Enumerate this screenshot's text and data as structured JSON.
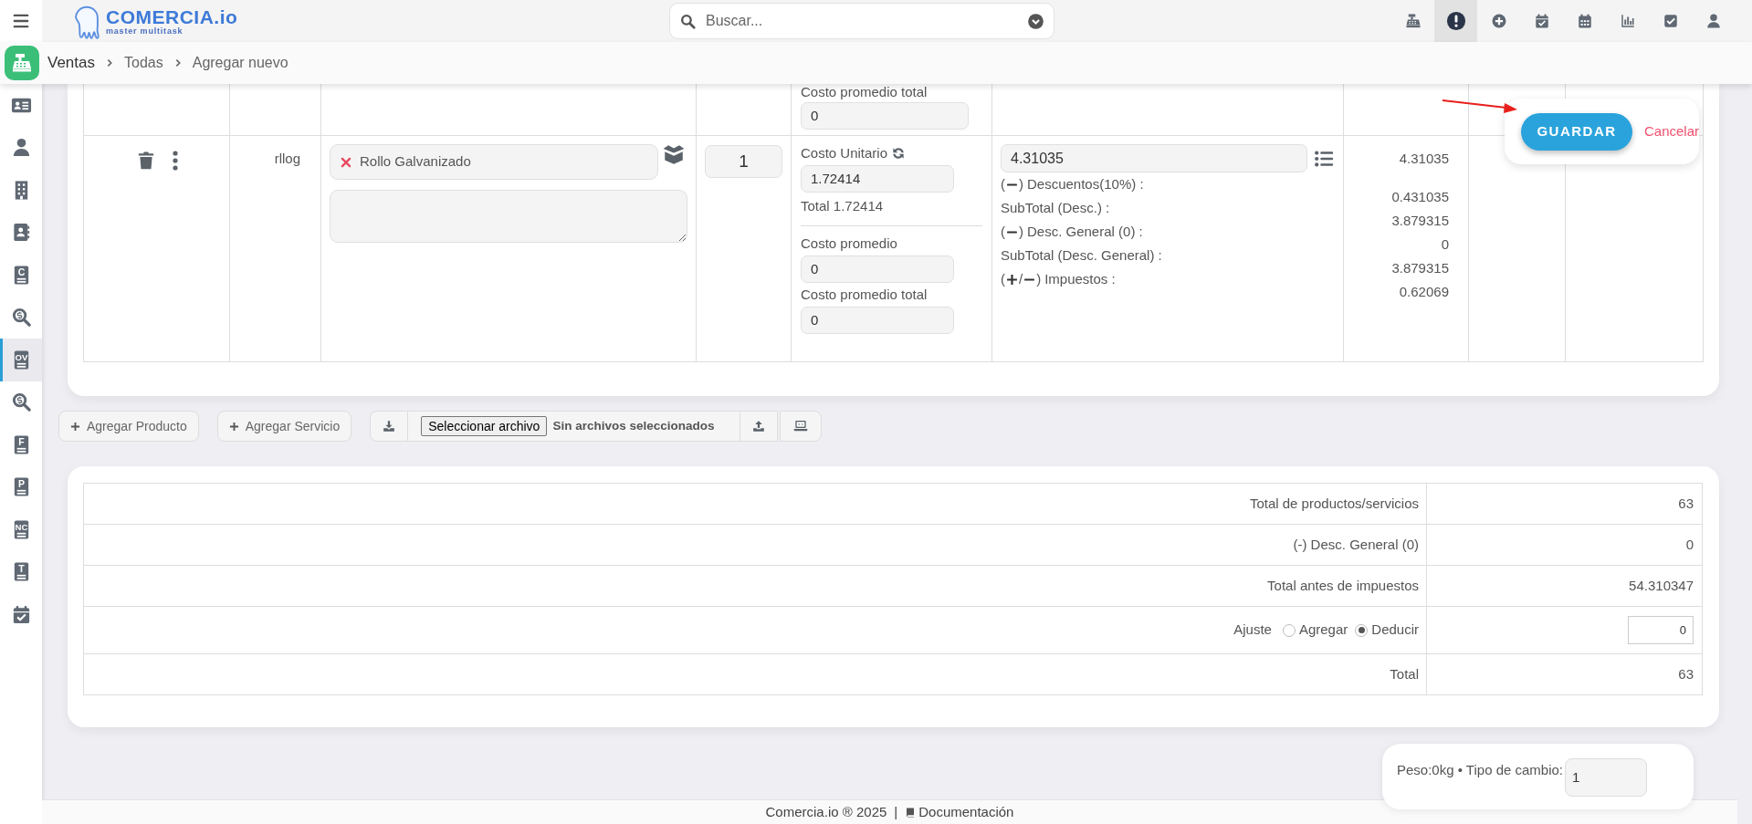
{
  "topbar": {
    "logo": {
      "name": "COMERCIA.io",
      "tagline": "master multitask"
    },
    "search": {
      "placeholder": "Buscar..."
    },
    "icons": [
      {
        "kind": "register",
        "selected": false
      },
      {
        "kind": "alert",
        "selected": true
      },
      {
        "kind": "plus-circle",
        "selected": false
      },
      {
        "kind": "calendar-check",
        "selected": false
      },
      {
        "kind": "calendar",
        "selected": false
      },
      {
        "kind": "chart",
        "selected": false
      },
      {
        "kind": "check-square",
        "selected": false
      },
      {
        "kind": "user",
        "selected": false
      }
    ]
  },
  "breadcrumb": [
    "Ventas",
    "Todas",
    "Agregar nuevo"
  ],
  "sidebar": {
    "items": [
      {
        "kind": "id-card",
        "selected": false
      },
      {
        "kind": "user",
        "selected": false
      },
      {
        "kind": "building",
        "selected": false
      },
      {
        "kind": "contact-book",
        "selected": false
      },
      {
        "kind": "doc",
        "letter": "C",
        "selected": false
      },
      {
        "kind": "search-dollar",
        "selected": false
      },
      {
        "kind": "doc",
        "letter": "OV",
        "selected": true
      },
      {
        "kind": "search-dollar",
        "selected": false
      },
      {
        "kind": "doc",
        "letter": "F",
        "selected": false
      },
      {
        "kind": "doc",
        "letter": "P",
        "selected": false
      },
      {
        "kind": "doc",
        "letter": "NC",
        "selected": false
      },
      {
        "kind": "doc",
        "letter": "T",
        "selected": false
      },
      {
        "kind": "calendar-check",
        "selected": false
      }
    ]
  },
  "line_items": {
    "partial_row": {
      "avg_total_label": "Costo promedio total",
      "avg_total": "0"
    },
    "row": {
      "code": "rllog",
      "product": "Rollo Galvanizado",
      "quantity": "1",
      "unit_cost_label": "Costo Unitario",
      "unit_cost": "1.72414",
      "total": "Total 1.72414",
      "avg_cost_label": "Costo promedio",
      "avg_cost": "0",
      "avg_total_label": "Costo promedio total",
      "avg_total": "0",
      "price": "4.31035",
      "price_value": "4.31035",
      "breakdown": [
        {
          "sign": [
            {
              "kind": "text",
              "text": "("
            },
            {
              "kind": "minus"
            },
            {
              "kind": "text",
              "text": ")"
            }
          ],
          "label": "Descuentos(10%) :",
          "value": "0.431035"
        },
        {
          "label": "SubTotal (Desc.) :",
          "value": "3.879315"
        },
        {
          "sign": [
            {
              "kind": "text",
              "text": "("
            },
            {
              "kind": "minus"
            },
            {
              "kind": "text",
              "text": ")"
            }
          ],
          "label": "Desc. General (0) :",
          "value": "0"
        },
        {
          "label": "SubTotal (Desc. General) :",
          "value": "3.879315"
        },
        {
          "sign": [
            {
              "kind": "text",
              "text": "("
            },
            {
              "kind": "plus"
            },
            {
              "kind": "text",
              "text": "/"
            },
            {
              "kind": "minus"
            },
            {
              "kind": "text",
              "text": ")"
            }
          ],
          "label": "Impuestos :",
          "value": "0.62069"
        }
      ]
    }
  },
  "actions": {
    "save": "GUARDAR",
    "cancel": "Cancelar"
  },
  "toolbar": {
    "add_product": "Agregar Producto",
    "add_service": "Agregar Servicio",
    "file_button": "Seleccionar archivo",
    "file_status": "Sin archivos seleccionados"
  },
  "totals": [
    {
      "kind": "plain",
      "label": "Total de productos/servicios",
      "value": "63"
    },
    {
      "kind": "plain",
      "label": "(-) Desc. General (0)",
      "value": "0"
    },
    {
      "kind": "plain",
      "label": "Total antes de impuestos",
      "value": "54.310347"
    },
    {
      "kind": "adjust",
      "label": "Ajuste",
      "options": [
        {
          "label": "Agregar",
          "selected": false
        },
        {
          "label": "Deducir",
          "selected": true
        }
      ],
      "value": "0"
    },
    {
      "kind": "plain",
      "label": "Total",
      "value": "63"
    }
  ],
  "summary": {
    "text": "Peso:0kg • Tipo de cambio:",
    "exchange_rate": "1"
  },
  "footer": {
    "brand": "Comercia.io ® 2025",
    "separator": "|",
    "link": "Documentación"
  }
}
